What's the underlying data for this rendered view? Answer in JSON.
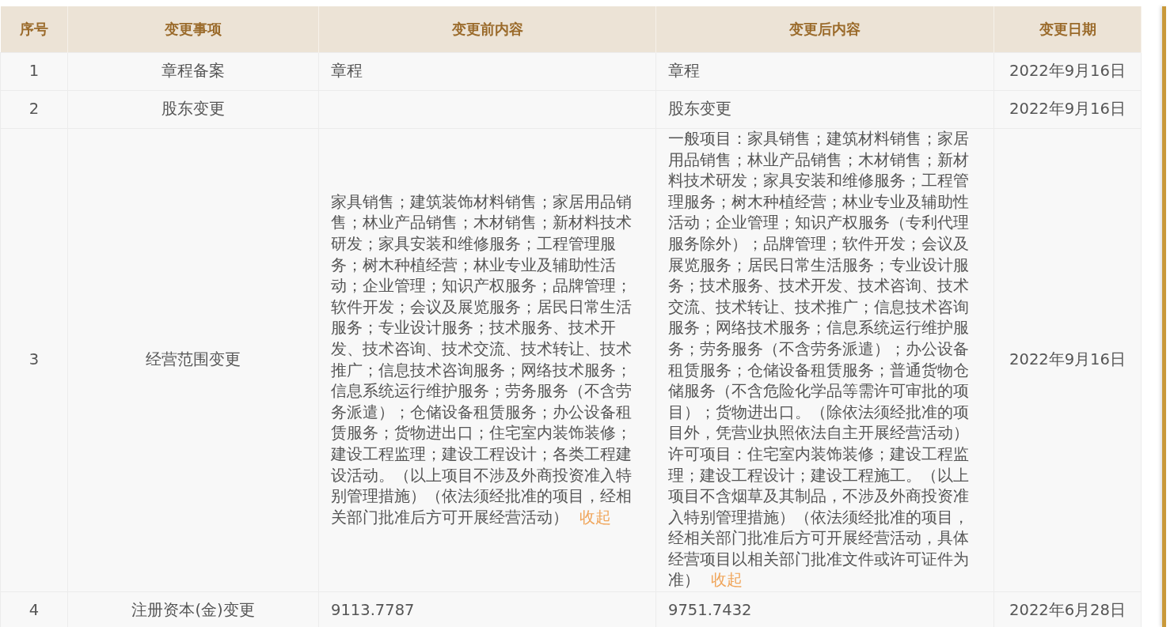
{
  "table": {
    "columns": [
      "序号",
      "变更事项",
      "变更前内容",
      "变更后内容",
      "变更日期"
    ],
    "rows": [
      {
        "index": "1",
        "item": "章程备案",
        "before": "章程",
        "after": "章程",
        "date": "2022年9月16日"
      },
      {
        "index": "2",
        "item": "股东变更",
        "after": "股东变更",
        "date": "2022年9月16日"
      },
      {
        "index": "3",
        "item": "经营范围变更",
        "before": "家具销售；建筑装饰材料销售；家居用品销售；林业产品销售；木材销售；新材料技术研发；家具安装和维修服务；工程管理服务；树木种植经营；林业专业及辅助性活动；企业管理；知识产权服务；品牌管理；软件开发；会议及展览服务；居民日常生活服务；专业设计服务；技术服务、技术开发、技术咨询、技术交流、技术转让、技术推广；信息技术咨询服务；网络技术服务；信息系统运行维护服务；劳务服务（不含劳务派遣）；仓储设备租赁服务；办公设备租赁服务；货物进出口；住宅室内装饰装修；建设工程监理；建设工程设计；各类工程建设活动。（以上项目不涉及外商投资准入特别管理措施）（依法须经批准的项目，经相关部门批准后方可开展经营活动）",
        "before_toggle": "收起",
        "after": "一般项目：家具销售；建筑材料销售；家居用品销售；林业产品销售；木材销售；新材料技术研发；家具安装和维修服务；工程管理服务；树木种植经营；林业专业及辅助性活动；企业管理；知识产权服务（专利代理服务除外）；品牌管理；软件开发；会议及展览服务；居民日常生活服务；专业设计服务；技术服务、技术开发、技术咨询、技术交流、技术转让、技术推广；信息技术咨询服务；网络技术服务；信息系统运行维护服务；劳务服务（不含劳务派遣）；办公设备租赁服务；仓储设备租赁服务；普通货物仓储服务（不含危险化学品等需许可审批的项目）；货物进出口。（除依法须经批准的项目外，凭营业执照依法自主开展经营活动）许可项目：住宅室内装饰装修；建设工程监理；建设工程设计；建设工程施工。（以上项目不含烟草及其制品，不涉及外商投资准入特别管理措施）（依法须经批准的项目，经相关部门批准后方可开展经营活动，具体经营项目以相关部门批准文件或许可证件为准）",
        "after_toggle": "收起",
        "date": "2022年9月16日"
      },
      {
        "index": "4",
        "item": "注册资本(金)变更",
        "before": "9113.7787",
        "after": "9751.7432",
        "date": "2022年6月28日"
      }
    ]
  }
}
